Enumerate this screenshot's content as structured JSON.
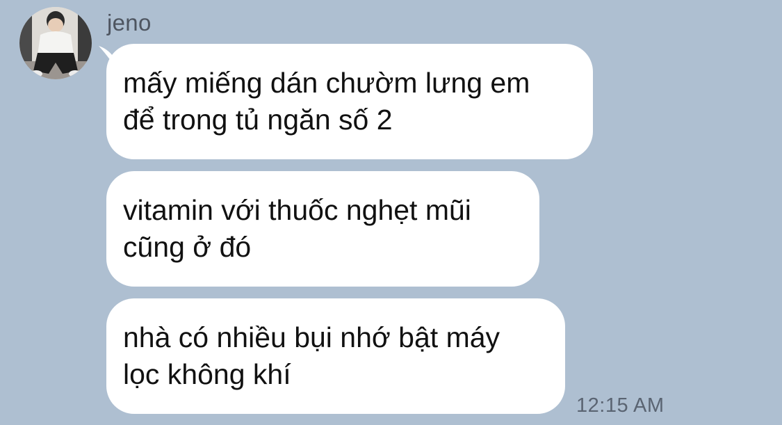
{
  "chat": {
    "sender_name": "jeno",
    "avatar_icon": "profile-photo",
    "messages": [
      {
        "lines": [
          "mấy miếng dán chườm lưng em",
          "để trong tủ ngăn số 2"
        ]
      },
      {
        "lines": [
          "vitamin với thuốc nghẹt mũi",
          "cũng ở đó"
        ]
      },
      {
        "lines": [
          "nhà có nhiều bụi nhớ bật máy",
          "lọc không khí"
        ]
      }
    ],
    "timestamp": "12:15 AM"
  },
  "colors": {
    "background": "#aebfd1",
    "bubble": "#ffffff",
    "text": "#111111",
    "meta_text": "#5a6472"
  }
}
